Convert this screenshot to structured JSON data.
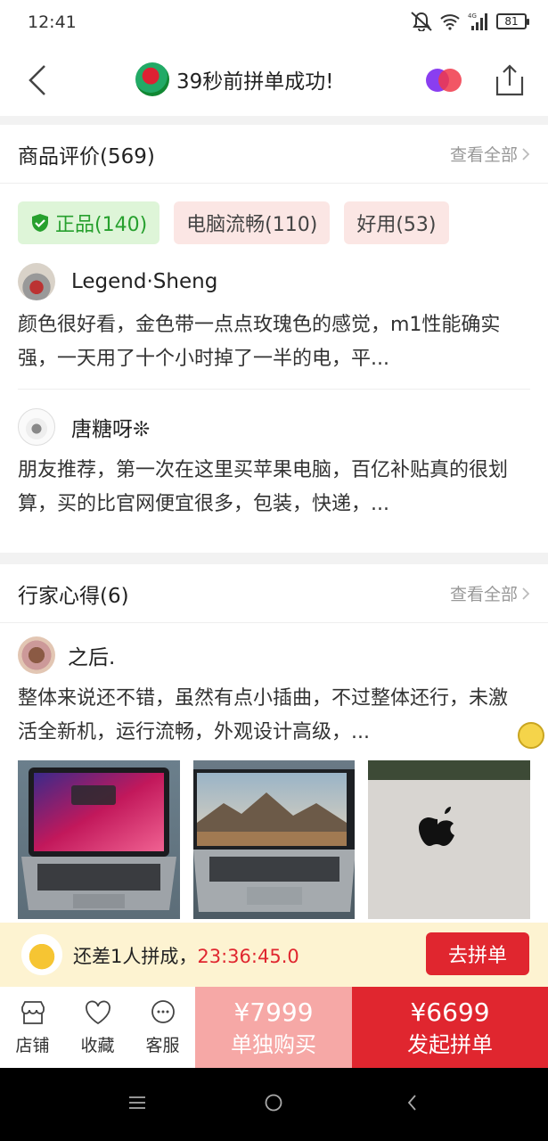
{
  "status_bar": {
    "time": "12:41",
    "network": "4G",
    "battery": "81"
  },
  "nav": {
    "title": "39秒前拼单成功!"
  },
  "reviews": {
    "title": "商品评价(569)",
    "see_all": "查看全部",
    "tags": [
      {
        "label": "正品(140)"
      },
      {
        "label": "电脑流畅(110)"
      },
      {
        "label": "好用(53)"
      }
    ],
    "items": [
      {
        "user": "Legend·Sheng",
        "text": "颜色很好看，金色带一点点玫瑰色的感觉，m1性能确实强，一天用了十个小时掉了一半的电，平..."
      },
      {
        "user": "唐糖呀❊",
        "text": "朋友推荐，第一次在这里买苹果电脑，百亿补贴真的很划算，买的比官网便宜很多，包装，快递，..."
      }
    ]
  },
  "expert": {
    "title": "行家心得(6)",
    "see_all": "查看全部",
    "item": {
      "user": "之后.",
      "text": "整体来说还不错，虽然有点小插曲，不过整体还行，未激活全新机，运行流畅，外观设计高级，..."
    }
  },
  "group_bar": {
    "text": "还差1人拼成，",
    "timer": "23:36:45.0",
    "button": "去拼单"
  },
  "bottom_bar": {
    "store": "店铺",
    "favorite": "收藏",
    "service": "客服",
    "single_price": "¥7999",
    "single_label": "单独购买",
    "group_price": "¥6699",
    "group_label": "发起拼单"
  },
  "colors": {
    "accent_red": "#e0262f",
    "light_red": "#f6a8a6",
    "green": "#27a02e",
    "group_bar_bg": "#fdf3d1"
  }
}
